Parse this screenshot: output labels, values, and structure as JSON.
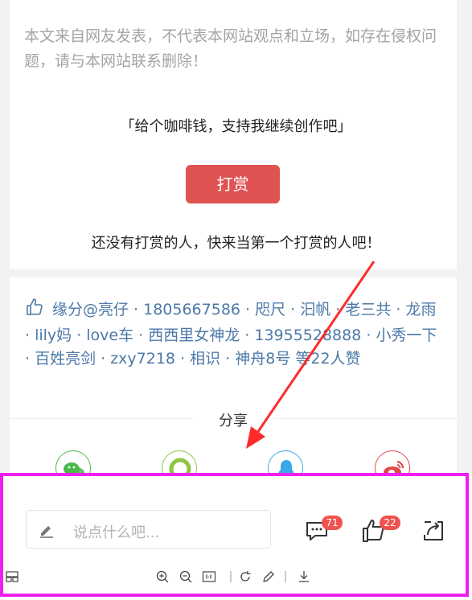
{
  "article": {
    "notice": "本文来自网友发表，不代表本网站观点和立场，如存在侵权问题，请与本网站联系删除！",
    "slogan": "「给个咖啡钱，支持我继续创作吧」",
    "tip_button": "打赏",
    "no_tips": "还没有打赏的人，快来当第一个打赏的人吧！"
  },
  "likes": {
    "icon": "thumbs-up-outline-icon",
    "text": "缘分@亮仔 · 1805667586 · 咫尺 · 汩帆 · 老三共 · 龙雨 · lily妈 · love车 · 西西里女神龙 · 13955528888 · 小秀一下 · 百姓亮剑 · zxy7218 · 相识 · 神舟8号 等22人赞"
  },
  "share": {
    "title": "分享",
    "targets": [
      {
        "icon": "wechat-icon",
        "color": "#4cb94c"
      },
      {
        "icon": "moments-icon",
        "color": "#8cc63f"
      },
      {
        "icon": "qq-icon",
        "color": "#3aa8e8"
      },
      {
        "icon": "weibo-icon",
        "color": "#e24a4a"
      }
    ]
  },
  "toolbar": {
    "comment_placeholder": "说点什么吧...",
    "comment_count": "71",
    "like_count": "22"
  },
  "colors": {
    "accent_red": "#e05353",
    "link_blue": "#4d79a8",
    "highlight_magenta": "#f01ff0",
    "arrow_red": "#ff2b2b"
  }
}
